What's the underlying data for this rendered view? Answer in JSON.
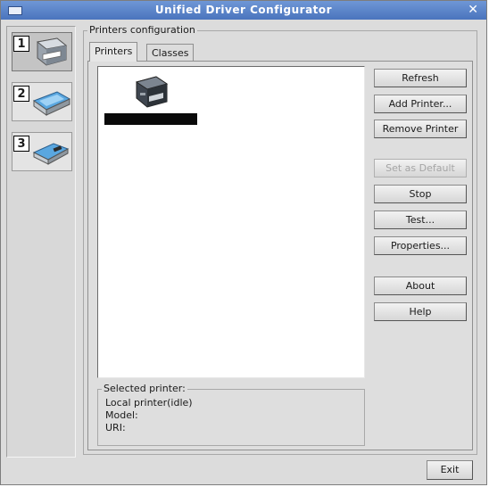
{
  "window": {
    "title": "Unified Driver Configurator"
  },
  "sidebar": {
    "items": [
      {
        "number": "1",
        "icon": "printer-icon"
      },
      {
        "number": "2",
        "icon": "scanner-icon"
      },
      {
        "number": "3",
        "icon": "port-icon"
      }
    ],
    "selected": 1
  },
  "printers_config": {
    "legend": "Printers configuration",
    "tabs": [
      {
        "label": "Printers"
      },
      {
        "label": "Classes"
      }
    ],
    "active_tab": "Printers",
    "printer_list": [
      {
        "icon": "printer-icon",
        "name": ""
      }
    ]
  },
  "buttons": {
    "refresh": "Refresh",
    "add_printer": "Add Printer...",
    "remove_printer": "Remove Printer",
    "set_default": "Set as Default",
    "stop": "Stop",
    "test": "Test...",
    "properties": "Properties...",
    "about": "About",
    "help": "Help",
    "exit": "Exit"
  },
  "selected_printer": {
    "legend": "Selected printer:",
    "status": "Local printer(idle)",
    "model_label": "Model:",
    "uri_label": "URI:"
  }
}
